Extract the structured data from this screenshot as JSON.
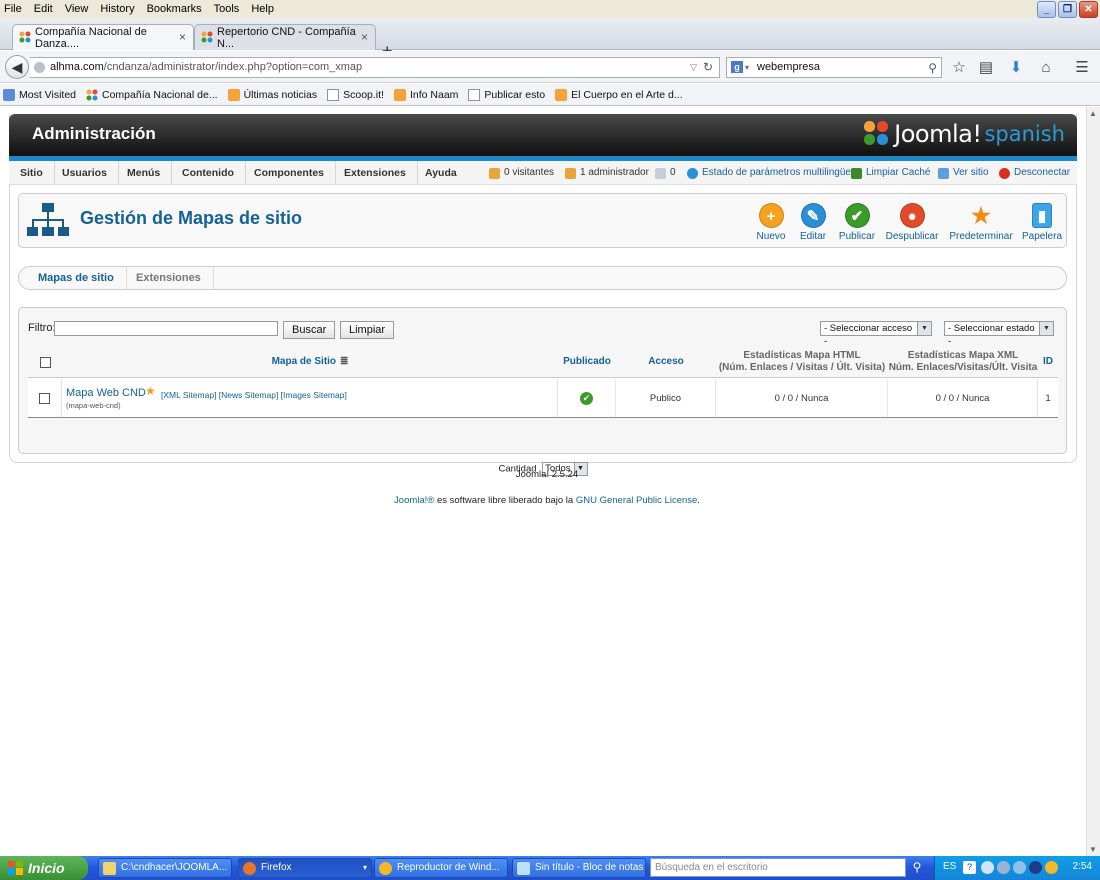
{
  "browser": {
    "menu": [
      "File",
      "Edit",
      "View",
      "History",
      "Bookmarks",
      "Tools",
      "Help"
    ],
    "window_buttons": [
      "_",
      "❐",
      "✕"
    ],
    "tabs": [
      {
        "title": "Compañía Nacional de Danza...."
      },
      {
        "title": "Repertorio CND - Compañía N..."
      }
    ],
    "new_tab": "+",
    "url_host": "alhma.com",
    "url_path": "/cndanza/administrator/index.php?option=com_xmap",
    "search_value": "webempresa",
    "bookmarks": [
      {
        "label": "Most Visited"
      },
      {
        "label": "Compañía Nacional de..."
      },
      {
        "label": "Últimas noticias"
      },
      {
        "label": "Scoop.it!"
      },
      {
        "label": "Info Naam"
      },
      {
        "label": "Publicar esto"
      },
      {
        "label": "El Cuerpo en el Arte d..."
      }
    ]
  },
  "admin": {
    "header_title": "Administración",
    "logo_word": "Joomla!",
    "logo_lang": "spanish",
    "menu": [
      "Sitio",
      "Usuarios",
      "Menús",
      "Contenido",
      "Componentes",
      "Extensiones",
      "Ayuda"
    ],
    "status": {
      "visitors": "0 visitantes",
      "admins": "1 administrador",
      "messages": "0",
      "multilang": "Estado de parámetros multilingüe",
      "cache": "Limpiar Caché",
      "view_site": "Ver sitio",
      "logout": "Desconectar"
    },
    "page_title": "Gestión de Mapas de sitio",
    "toolbar": [
      {
        "label": "Nuevo",
        "icon": "plus-icon",
        "color": "#f6a21e"
      },
      {
        "label": "Editar",
        "icon": "pencil-icon",
        "color": "#2a8fd6"
      },
      {
        "label": "Publicar",
        "icon": "check-icon",
        "color": "#3b9b2a"
      },
      {
        "label": "Despublicar",
        "icon": "unpublish-icon",
        "color": "#e34a2a"
      },
      {
        "label": "Predeterminar",
        "icon": "star-icon",
        "color": "#f28a16"
      },
      {
        "label": "Papelera",
        "icon": "trash-icon",
        "color": "#3aa6e8"
      }
    ],
    "subtabs": [
      "Mapas de sitio",
      "Extensiones"
    ],
    "filter": {
      "label": "Filtro:",
      "value": "",
      "search_button": "Buscar",
      "clear_button": "Limpiar",
      "access_select": "- Seleccionar acceso -",
      "state_select": "- Seleccionar estado -"
    },
    "table": {
      "headers": {
        "title": "Mapa de Sitio",
        "published": "Publicado",
        "access": "Acceso",
        "html_stats_1": "Estadísticas Mapa HTML",
        "html_stats_2": "(Núm. Enlaces / Visitas / Últ. Visita)",
        "xml_stats_1": "Estadísticas Mapa XML",
        "xml_stats_2": "Núm. Enlaces/Visitas/Últ. Visita",
        "id": "ID"
      },
      "rows": [
        {
          "title": "Mapa Web CND",
          "alias": "(mapa-web-cnd)",
          "links": "[XML Sitemap] [News Sitemap] [Images Sitemap]",
          "access": "Publico",
          "html_stats": "0 / 0 / Nunca",
          "xml_stats": "0 / 0 / Nunca",
          "id": "1"
        }
      ],
      "quantity_label": "Cantidad",
      "quantity_value": "Todos"
    },
    "version": "Joomla! 2.5.24",
    "license_a": "Joomla!®",
    "license_b": " es software libre liberado bajo la ",
    "license_c": "GNU General Public License",
    "license_d": "."
  },
  "taskbar": {
    "start": "Inicio",
    "tasks": [
      {
        "label": "C:\\cndhacer\\JOOMLA..."
      },
      {
        "label": "Firefox"
      },
      {
        "label": "Reproductor de Wind..."
      },
      {
        "label": "Sin título - Bloc de notas"
      }
    ],
    "search_placeholder": "Búsqueda en el escritorio",
    "lang": "ES",
    "clock": "2:54"
  }
}
